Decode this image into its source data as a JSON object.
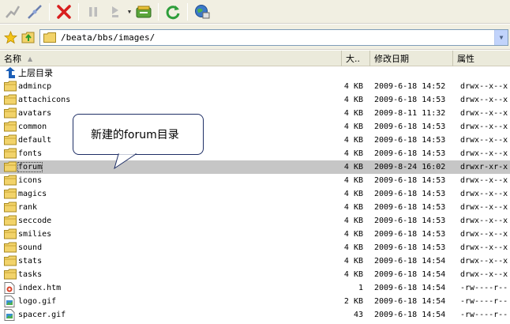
{
  "toolbar": {
    "buttons": [
      "disconnect-icon",
      "connect-icon",
      "cancel-icon",
      "pause-icon",
      "play-icon",
      "transfer-icon",
      "refresh-icon",
      "globe-icon"
    ]
  },
  "address": {
    "path": "/beata/bbs/images/"
  },
  "columns": {
    "name": "名称",
    "size": "大..",
    "modified": "修改日期",
    "attr": "属性"
  },
  "parent_dir": "上层目录",
  "files": [
    {
      "name": "admincp",
      "type": "folder",
      "size": "4 KB",
      "modified": "2009-6-18 14:52",
      "attr": "drwx--x--x"
    },
    {
      "name": "attachicons",
      "type": "folder",
      "size": "4 KB",
      "modified": "2009-6-18 14:53",
      "attr": "drwx--x--x"
    },
    {
      "name": "avatars",
      "type": "folder",
      "size": "4 KB",
      "modified": "2009-8-11 11:32",
      "attr": "drwx--x--x"
    },
    {
      "name": "common",
      "type": "folder",
      "size": "4 KB",
      "modified": "2009-6-18 14:53",
      "attr": "drwx--x--x"
    },
    {
      "name": "default",
      "type": "folder",
      "size": "4 KB",
      "modified": "2009-6-18 14:53",
      "attr": "drwx--x--x"
    },
    {
      "name": "fonts",
      "type": "folder",
      "size": "4 KB",
      "modified": "2009-6-18 14:53",
      "attr": "drwx--x--x"
    },
    {
      "name": "forum",
      "type": "folder",
      "size": "4 KB",
      "modified": "2009-8-24 16:02",
      "attr": "drwxr-xr-x",
      "selected": true
    },
    {
      "name": "icons",
      "type": "folder",
      "size": "4 KB",
      "modified": "2009-6-18 14:53",
      "attr": "drwx--x--x"
    },
    {
      "name": "magics",
      "type": "folder",
      "size": "4 KB",
      "modified": "2009-6-18 14:53",
      "attr": "drwx--x--x"
    },
    {
      "name": "rank",
      "type": "folder",
      "size": "4 KB",
      "modified": "2009-6-18 14:53",
      "attr": "drwx--x--x"
    },
    {
      "name": "seccode",
      "type": "folder",
      "size": "4 KB",
      "modified": "2009-6-18 14:53",
      "attr": "drwx--x--x"
    },
    {
      "name": "smilies",
      "type": "folder",
      "size": "4 KB",
      "modified": "2009-6-18 14:53",
      "attr": "drwx--x--x"
    },
    {
      "name": "sound",
      "type": "folder",
      "size": "4 KB",
      "modified": "2009-6-18 14:53",
      "attr": "drwx--x--x"
    },
    {
      "name": "stats",
      "type": "folder",
      "size": "4 KB",
      "modified": "2009-6-18 14:54",
      "attr": "drwx--x--x"
    },
    {
      "name": "tasks",
      "type": "folder",
      "size": "4 KB",
      "modified": "2009-6-18 14:54",
      "attr": "drwx--x--x"
    },
    {
      "name": "index.htm",
      "type": "htm",
      "size": "1",
      "modified": "2009-6-18 14:54",
      "attr": "-rw----r--"
    },
    {
      "name": "logo.gif",
      "type": "gif",
      "size": "2 KB",
      "modified": "2009-6-18 14:54",
      "attr": "-rw----r--"
    },
    {
      "name": "spacer.gif",
      "type": "gif",
      "size": "43",
      "modified": "2009-6-18 14:54",
      "attr": "-rw----r--"
    }
  ],
  "callout": {
    "text": "新建的forum目录"
  },
  "colors": {
    "selected_row": "#c6c6c6",
    "folder": "#f2d36a",
    "toolbar_bg": "#f1efe2"
  }
}
